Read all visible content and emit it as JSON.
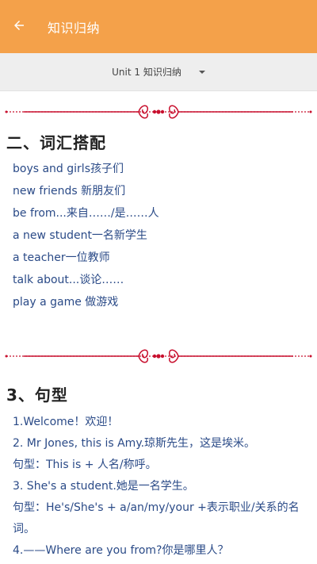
{
  "appbar": {
    "title": "知识归纳",
    "back_icon": "arrow-left-icon",
    "color": "#f4a14a"
  },
  "selector": {
    "value": "Unit 1 知识归纳",
    "icon": "caret-down-icon"
  },
  "section_vocab": {
    "heading": "二、词汇搭配",
    "items": [
      "boys and girls孩子们",
      "new friends 新朋友们",
      "be from...来自……/是……人",
      "a new student一名新学生",
      "a teacher一位教师",
      "talk about...谈论……",
      "play a game 做游戏"
    ]
  },
  "section_pattern": {
    "heading": "3、句型",
    "items": [
      "1.Welcome！欢迎！",
      "2. Mr Jones, this is Amy.琼斯先生，这是埃米。",
      "句型：This is + 人名/称呼。",
      "3. She's a student.她是一名学生。",
      "句型：He's/She's + a/an/my/your +表示职业/关系的名词。",
      "4.——Where are you from?你是哪里人？"
    ]
  },
  "colors": {
    "divider": "#c8102e",
    "text_link": "#2a4a87"
  }
}
